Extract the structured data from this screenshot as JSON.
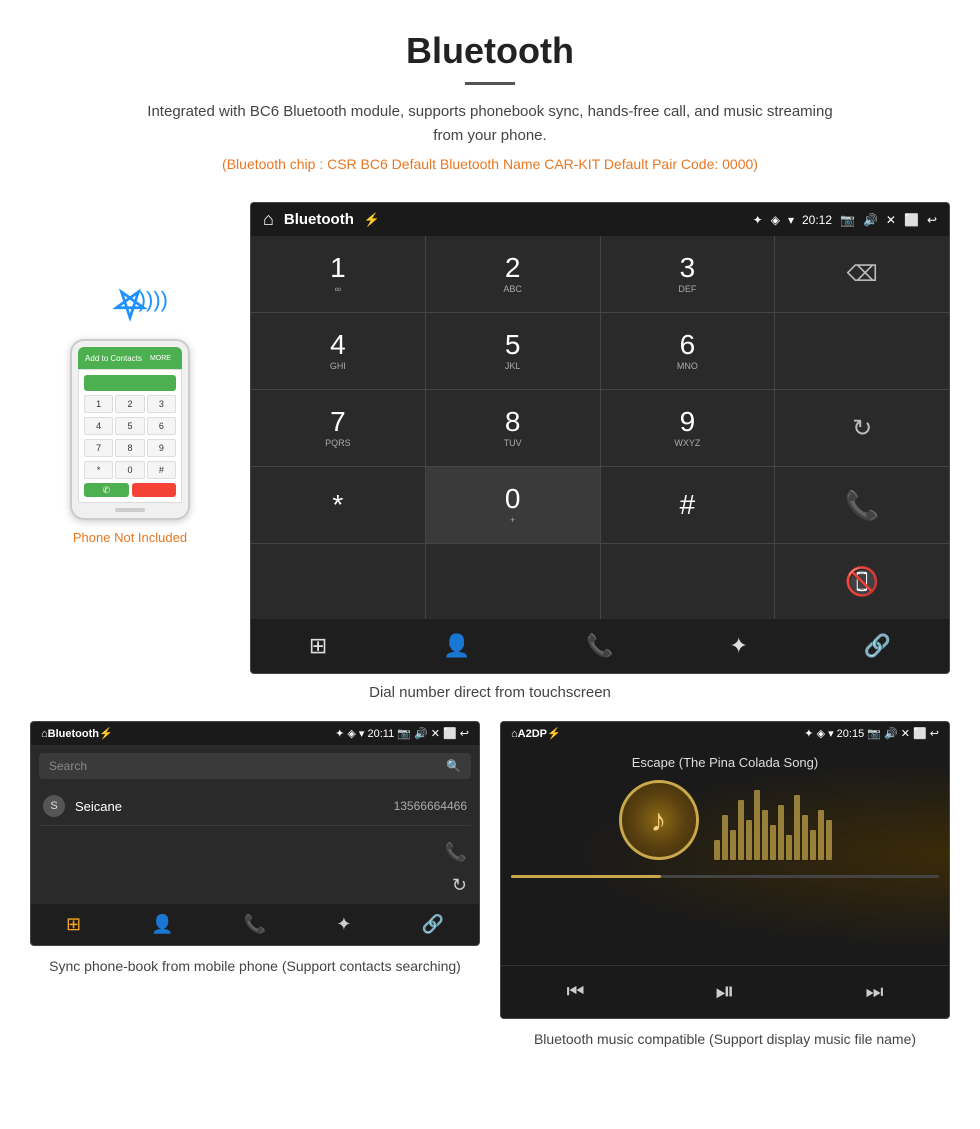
{
  "header": {
    "title": "Bluetooth",
    "description": "Integrated with BC6 Bluetooth module, supports phonebook sync, hands-free call, and music streaming from your phone.",
    "specs": "(Bluetooth chip : CSR BC6   Default Bluetooth Name CAR-KIT   Default Pair Code: 0000)"
  },
  "phone_aside": {
    "not_included_label": "Phone Not Included",
    "add_to_contacts": "Add to Contacts"
  },
  "main_screen": {
    "status_bar": {
      "home_icon": "⌂",
      "title": "Bluetooth",
      "usb_icon": "⚡",
      "bt_icon": "✦",
      "location_icon": "◈",
      "wifi_icon": "▾",
      "time": "20:12",
      "camera_icon": "📷",
      "volume_icon": "🔊",
      "close_icon": "✕",
      "window_icon": "⬜",
      "back_icon": "↩"
    },
    "dial_keys": [
      {
        "number": "1",
        "letters": "∞"
      },
      {
        "number": "2",
        "letters": "ABC"
      },
      {
        "number": "3",
        "letters": "DEF"
      },
      {
        "number": "",
        "letters": "",
        "type": "backspace"
      },
      {
        "number": "4",
        "letters": "GHI"
      },
      {
        "number": "5",
        "letters": "JKL"
      },
      {
        "number": "6",
        "letters": "MNO"
      },
      {
        "number": "",
        "letters": "",
        "type": "empty"
      },
      {
        "number": "7",
        "letters": "PQRS"
      },
      {
        "number": "8",
        "letters": "TUV"
      },
      {
        "number": "9",
        "letters": "WXYZ"
      },
      {
        "number": "",
        "letters": "",
        "type": "refresh"
      },
      {
        "number": "*",
        "letters": ""
      },
      {
        "number": "0",
        "letters": "+"
      },
      {
        "number": "#",
        "letters": ""
      },
      {
        "number": "",
        "letters": "",
        "type": "call"
      },
      {
        "number": "",
        "letters": "",
        "type": "empty2"
      },
      {
        "number": "",
        "letters": "",
        "type": "empty3"
      },
      {
        "number": "",
        "letters": "",
        "type": "empty4"
      },
      {
        "number": "",
        "letters": "",
        "type": "end-call"
      }
    ],
    "toolbar": {
      "grid_icon": "⋮⋮",
      "person_icon": "👤",
      "phone_icon": "📞",
      "bt_icon": "✦",
      "link_icon": "🔗"
    }
  },
  "main_caption": "Dial number direct from touchscreen",
  "phonebook_screen": {
    "status_bar": {
      "home": "⌂",
      "title": "Bluetooth",
      "usb": "⚡",
      "right": "✦ ◈ ▾ 20:11 📷 🔊 ✕ ⬜ ↩"
    },
    "search_placeholder": "Search",
    "entries": [
      {
        "avatar": "S",
        "name": "Seicane",
        "number": "13566664466"
      }
    ],
    "toolbar": {
      "grid": "⋮⋮",
      "person": "👤",
      "phone": "📞",
      "bt": "✦",
      "link": "🔗"
    }
  },
  "phonebook_caption": "Sync phone-book from mobile phone\n(Support contacts searching)",
  "music_screen": {
    "status_bar": {
      "home": "⌂",
      "title": "A2DP",
      "usb": "⚡",
      "right": "✦ ◈ ▾ 20:15 📷 🔊 ✕ ⬜ ↩"
    },
    "song_title": "Escape (The Pina Colada Song)",
    "music_icon": "♪",
    "toolbar": {
      "prev": "⏮",
      "play_pause": "⏯",
      "next": "⏭"
    }
  },
  "music_caption": "Bluetooth music compatible\n(Support display music file name)",
  "watermark": "Seicane"
}
